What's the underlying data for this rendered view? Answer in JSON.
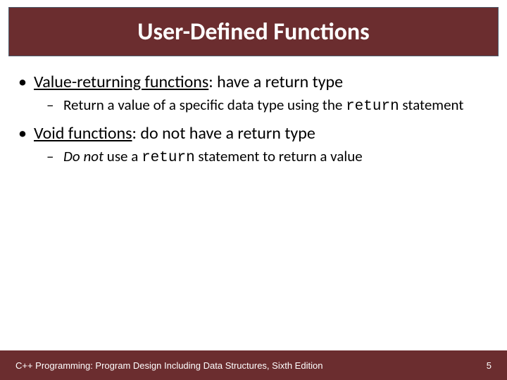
{
  "title": "User-Defined Functions",
  "bullets": {
    "p1": {
      "term": "Value-returning functions",
      "rest": ": have a return type",
      "sub": {
        "pre": "Return a value of a specific data type using the ",
        "code": "return",
        "post": " statement"
      }
    },
    "p2": {
      "term": "Void functions",
      "rest": ": do not have a return type",
      "sub": {
        "emph": "Do not",
        "mid": " use a ",
        "code": "return",
        "post": " statement to return a value"
      }
    }
  },
  "footer": {
    "text": "C++ Programming: Program Design Including Data Structures, Sixth Edition",
    "page": "5"
  }
}
